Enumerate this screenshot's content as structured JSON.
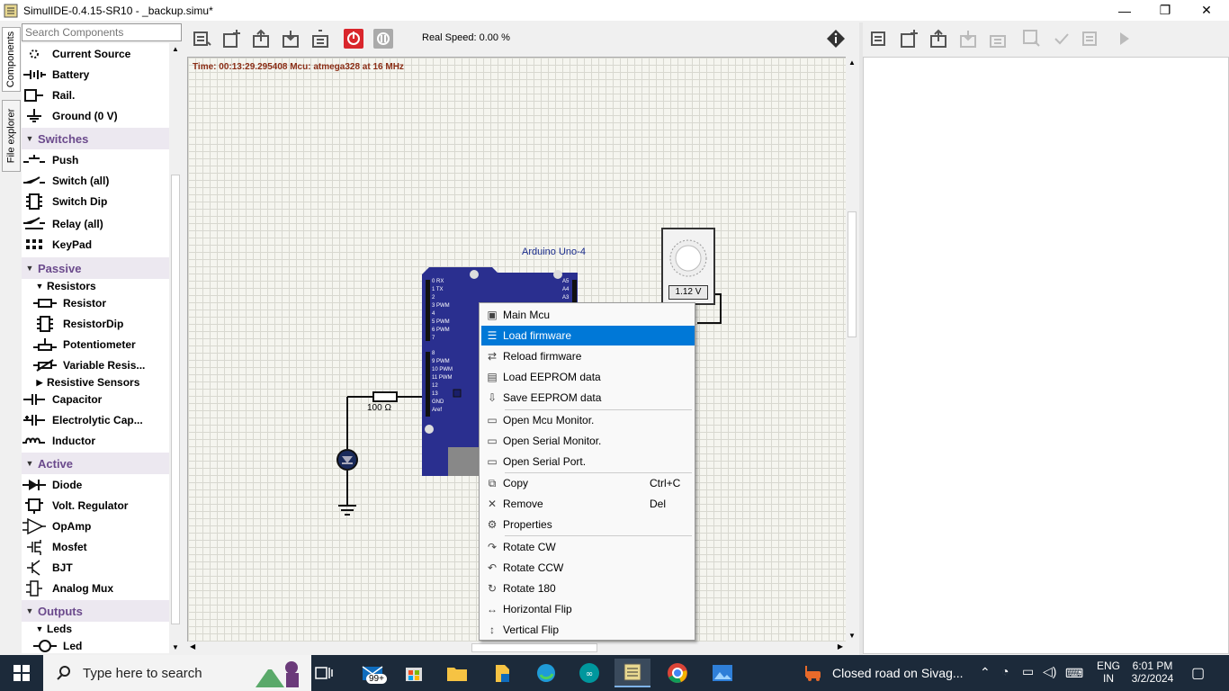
{
  "window": {
    "title": "SimulIDE-0.4.15-SR10  -  _backup.simu*",
    "minimize": "—",
    "maximize": "❐",
    "close": "✕"
  },
  "sidebar": {
    "tabs": [
      "Components",
      "File explorer"
    ],
    "search_placeholder": "Search Components",
    "items": [
      {
        "label": "Current Source",
        "icon": "current-source-icon"
      },
      {
        "label": "Battery",
        "icon": "battery-icon"
      },
      {
        "label": "Rail.",
        "icon": "rail-icon"
      },
      {
        "label": "Ground (0 V)",
        "icon": "ground-icon"
      }
    ],
    "switches": {
      "label": "Switches",
      "items": [
        "Push",
        "Switch (all)",
        "Switch Dip",
        "Relay (all)",
        "KeyPad"
      ]
    },
    "passive": {
      "label": "Passive",
      "resistors": {
        "label": "Resistors",
        "items": [
          "Resistor",
          "ResistorDip",
          "Potentiometer",
          "Variable Resis..."
        ]
      },
      "resistive_sensors": "Resistive Sensors",
      "items": [
        "Capacitor",
        "Electrolytic Cap...",
        "Inductor"
      ]
    },
    "active": {
      "label": "Active",
      "items": [
        "Diode",
        "Volt. Regulator",
        "OpAmp",
        "Mosfet",
        "BJT",
        "Analog Mux"
      ]
    },
    "outputs": {
      "label": "Outputs",
      "leds": "Leds",
      "items": [
        "Led"
      ]
    }
  },
  "toolbar": {
    "speed": "Real Speed: 0.00 %"
  },
  "canvas": {
    "status": "Time: 00:13:29.295408      Mcu: atmega328 at 16 MHz",
    "arduino_label": "Arduino Uno-4",
    "pot_value": "1.12 V",
    "resistor_label": "100 Ω",
    "pin_labels_left": [
      "0 RX",
      "1 TX",
      "2",
      "3 PWM",
      "4",
      "5 PWM",
      "6 PWM",
      "7",
      "8",
      "9  PWM",
      "10 PWM",
      "11 PWM",
      "12",
      "13",
      "GND",
      "Aref"
    ],
    "pin_labels_right": [
      "A5",
      "A4",
      "A3"
    ]
  },
  "context_menu": {
    "items": [
      {
        "label": "Main Mcu",
        "icon": "chip-icon",
        "shortcut": ""
      },
      {
        "label": "Load firmware",
        "icon": "load-icon",
        "shortcut": "",
        "selected": true
      },
      {
        "label": "Reload firmware",
        "icon": "reload-icon",
        "shortcut": ""
      },
      {
        "label": "Load EEPROM data",
        "icon": "load-eeprom-icon",
        "shortcut": ""
      },
      {
        "label": "Save EEPROM data",
        "icon": "save-eeprom-icon",
        "shortcut": ""
      },
      {
        "label": "Open Mcu Monitor.",
        "icon": "monitor-icon",
        "shortcut": ""
      },
      {
        "label": "Open Serial Monitor.",
        "icon": "monitor-icon",
        "shortcut": ""
      },
      {
        "label": "Open Serial Port.",
        "icon": "monitor-icon",
        "shortcut": ""
      },
      {
        "label": "Copy",
        "icon": "copy-icon",
        "shortcut": "Ctrl+C"
      },
      {
        "label": "Remove",
        "icon": "remove-icon",
        "shortcut": "Del"
      },
      {
        "label": "Properties",
        "icon": "properties-icon",
        "shortcut": ""
      },
      {
        "label": "Rotate CW",
        "icon": "rotate-cw-icon",
        "shortcut": ""
      },
      {
        "label": "Rotate CCW",
        "icon": "rotate-ccw-icon",
        "shortcut": ""
      },
      {
        "label": "Rotate 180",
        "icon": "rotate-180-icon",
        "shortcut": ""
      },
      {
        "label": "Horizontal Flip",
        "icon": "hflip-icon",
        "shortcut": ""
      },
      {
        "label": "Vertical Flip",
        "icon": "vflip-icon",
        "shortcut": ""
      }
    ]
  },
  "taskbar": {
    "search_placeholder": "Type here to search",
    "mail_badge": "99+",
    "notification": "Closed road on Sivag...",
    "lang": "ENG",
    "region": "IN",
    "time": "6:01 PM",
    "date": "3/2/2024"
  }
}
